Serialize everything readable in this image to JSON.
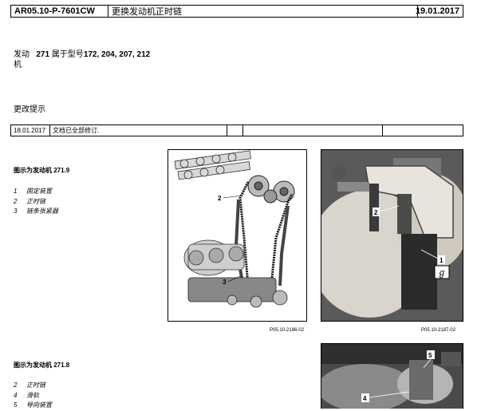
{
  "header": {
    "doc_id": "AR05.10-P-7601CW",
    "title": "更换发动机正时链",
    "date": "19.01.2017"
  },
  "engine": {
    "label_line1": "发动",
    "label_line2": "机",
    "number": "271",
    "text_mid": "属于型号",
    "models": "172, 204, 207, 212"
  },
  "change_notes": {
    "heading": "更改提示",
    "date": "18.01.2017",
    "text": "文档已全部修订."
  },
  "section1": {
    "title": "图示为发动机 271.9",
    "legend": [
      {
        "num": "1",
        "text": "固定装置"
      },
      {
        "num": "2",
        "text": "正时链"
      },
      {
        "num": "3",
        "text": "链条张紧器"
      }
    ],
    "fig1": {
      "caption": "P05.10-2186-02",
      "callouts": [
        "2",
        "3"
      ]
    },
    "fig2": {
      "caption": "P05.10-2187-02",
      "callouts": [
        "2",
        "1"
      ]
    }
  },
  "section2": {
    "title": "图示为发动机 271.8",
    "legend": [
      {
        "num": "2",
        "text": "正时链"
      },
      {
        "num": "4",
        "text": "滑轨"
      },
      {
        "num": "5",
        "text": "导向装置"
      }
    ],
    "fig3": {
      "callouts": [
        "5",
        "4"
      ]
    }
  }
}
